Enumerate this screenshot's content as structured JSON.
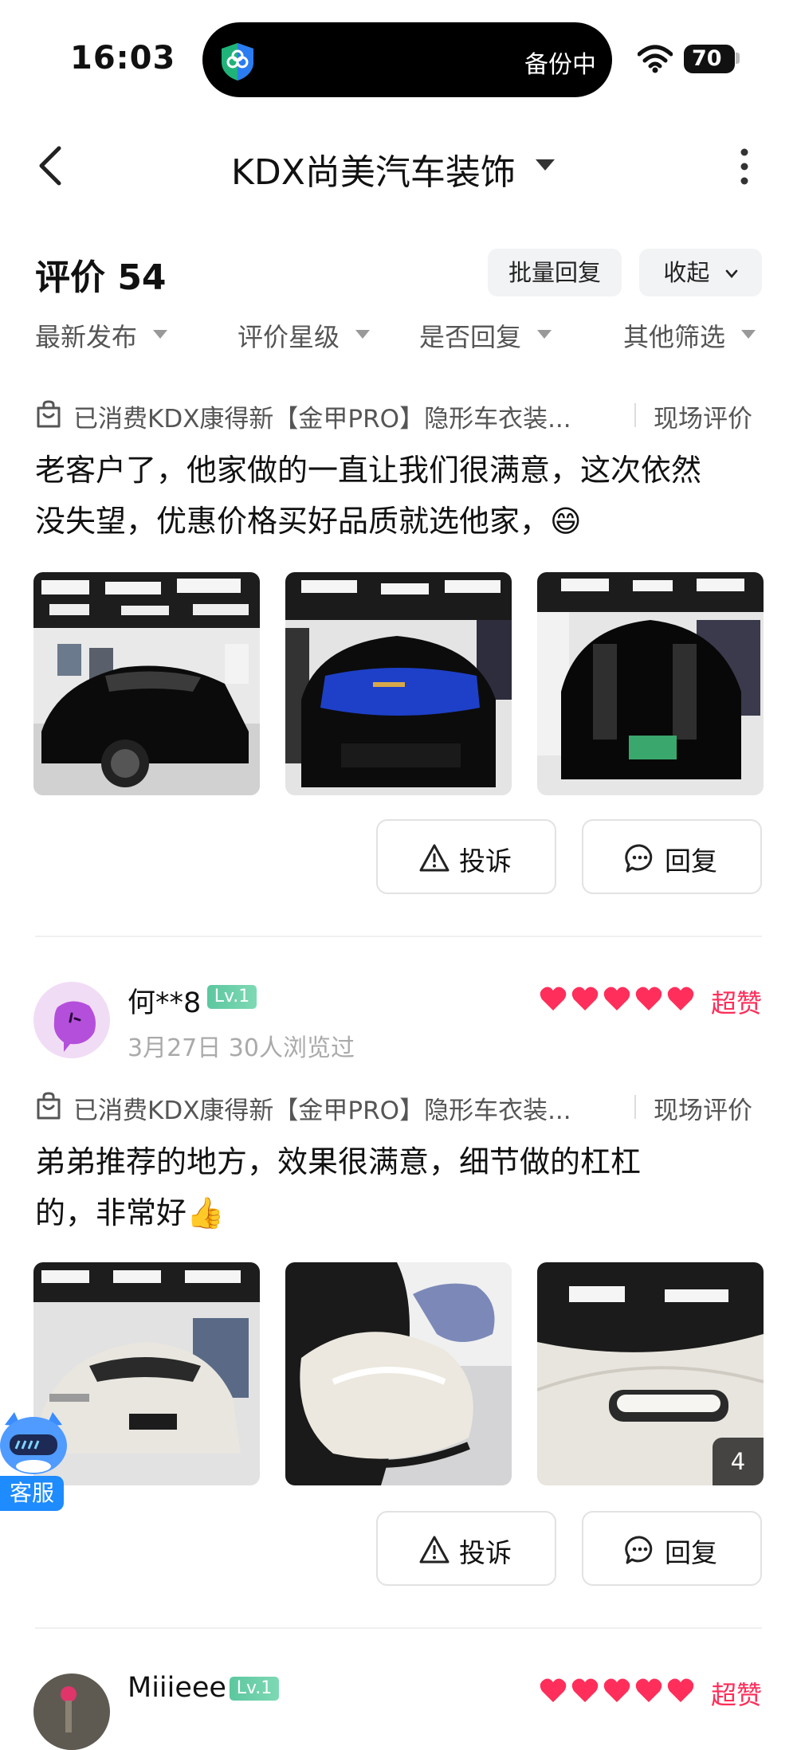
{
  "status_bar": {
    "time": "16:03",
    "island_text": "备份中",
    "battery": "70"
  },
  "nav": {
    "title": "KDX尚美汽车装饰"
  },
  "header": {
    "title": "评价 54",
    "batch_reply": "批量回复",
    "fold": "收起"
  },
  "filters": [
    "最新发布",
    "评价星级",
    "是否回复",
    "其他筛选"
  ],
  "reviews": [
    {
      "consumed": "已消费KDX康得新【金甲PRO】隐形车衣装...",
      "scene": "现场评价",
      "content": "老客户了，他家做的一直让我们很满意，这次依然没失望，优惠价格买好品质就选他家，😄",
      "complain": "投诉",
      "reply": "回复"
    },
    {
      "user": "何**8",
      "level": "Lv.1",
      "meta": "3月27日 30人浏览过",
      "rating_text": "超赞",
      "consumed": "已消费KDX康得新【金甲PRO】隐形车衣装...",
      "scene": "现场评价",
      "content": "弟弟推荐的地方，效果很满意，细节做的杠杠的，非常好👍",
      "photo_count": "4",
      "complain": "投诉",
      "reply": "回复"
    },
    {
      "user": "Miiieee",
      "level": "Lv.1",
      "rating_text": "超赞"
    }
  ],
  "service": {
    "label": "客服"
  },
  "colors": {
    "accent": "#ff2e5a",
    "level_badge": "#5cc7a0",
    "service": "#1e8bff"
  }
}
